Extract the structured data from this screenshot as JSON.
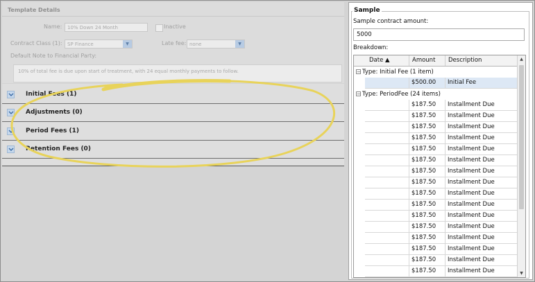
{
  "template_details": {
    "title": "Template Details",
    "name_label": "Name:",
    "name_value": "10% Down 24 Month",
    "inactive_label": "Inactive",
    "contract_class_label": "Contract Class (1):",
    "contract_class_value": "SP Finance",
    "late_fee_label": "Late fee:",
    "late_fee_value": "none",
    "default_note_label": "Default Note to Financial Party:",
    "default_note_value": "10% of total fee is due upon start of treatment, with 24 equal monthly payments to follow."
  },
  "sections": [
    {
      "label": "Initial Fees (1)"
    },
    {
      "label": "Adjustments (0)"
    },
    {
      "label": "Period Fees (1)"
    },
    {
      "label": "Retention Fees (0)"
    }
  ],
  "sample": {
    "title": "Sample",
    "amount_label": "Sample contract amount:",
    "amount_value": "5000",
    "breakdown_label": "Breakdown:",
    "columns": {
      "date": "Date ▲",
      "amount": "Amount",
      "description": "Description"
    },
    "groups": [
      {
        "label": "Type: Initial Fee (1 item)",
        "rows": [
          {
            "date": "",
            "amount": "$500.00",
            "description": "Initial Fee"
          }
        ]
      },
      {
        "label": "Type: PeriodFee (24 items)",
        "rows": [
          {
            "date": "",
            "amount": "$187.50",
            "description": "Installment Due"
          },
          {
            "date": "",
            "amount": "$187.50",
            "description": "Installment Due"
          },
          {
            "date": "",
            "amount": "$187.50",
            "description": "Installment Due"
          },
          {
            "date": "",
            "amount": "$187.50",
            "description": "Installment Due"
          },
          {
            "date": "",
            "amount": "$187.50",
            "description": "Installment Due"
          },
          {
            "date": "",
            "amount": "$187.50",
            "description": "Installment Due"
          },
          {
            "date": "",
            "amount": "$187.50",
            "description": "Installment Due"
          },
          {
            "date": "",
            "amount": "$187.50",
            "description": "Installment Due"
          },
          {
            "date": "",
            "amount": "$187.50",
            "description": "Installment Due"
          },
          {
            "date": "",
            "amount": "$187.50",
            "description": "Installment Due"
          },
          {
            "date": "",
            "amount": "$187.50",
            "description": "Installment Due"
          },
          {
            "date": "",
            "amount": "$187.50",
            "description": "Installment Due"
          },
          {
            "date": "",
            "amount": "$187.50",
            "description": "Installment Due"
          },
          {
            "date": "",
            "amount": "$187.50",
            "description": "Installment Due"
          },
          {
            "date": "",
            "amount": "$187.50",
            "description": "Installment Due"
          },
          {
            "date": "",
            "amount": "$187.50",
            "description": "Installment Due"
          },
          {
            "date": "",
            "amount": "$187.50",
            "description": "Installment Due"
          }
        ]
      }
    ]
  },
  "colors": {
    "highlight": "#e8d35a",
    "selected_row": "#dde8f5",
    "expander": "#c6d8ec"
  }
}
